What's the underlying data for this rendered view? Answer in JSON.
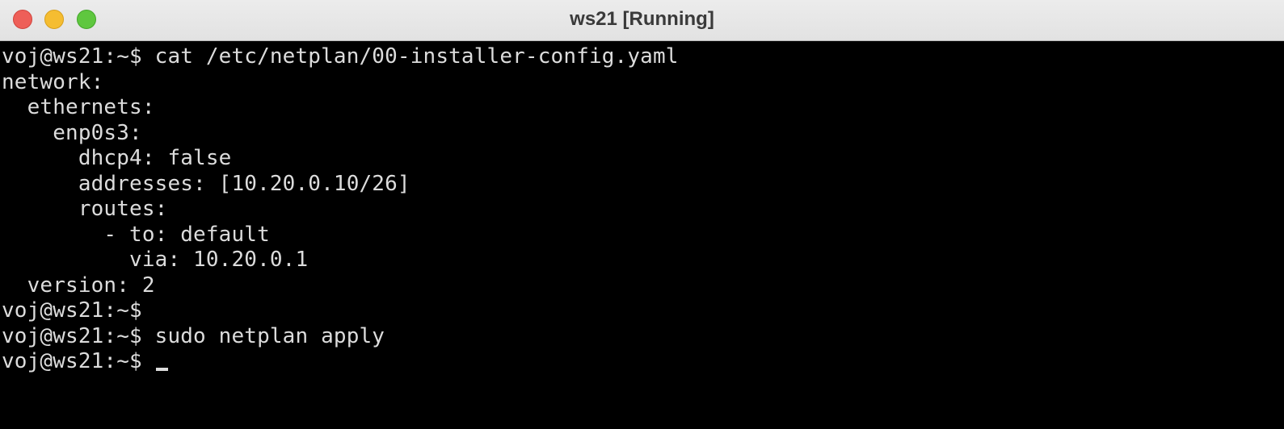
{
  "window": {
    "title": "ws21 [Running]"
  },
  "terminal": {
    "lines": [
      "voj@ws21:~$ cat /etc/netplan/00-installer-config.yaml",
      "network:",
      "  ethernets:",
      "    enp0s3:",
      "      dhcp4: false",
      "      addresses: [10.20.0.10/26]",
      "      routes:",
      "        - to: default",
      "          via: 10.20.0.1",
      "  version: 2",
      "voj@ws21:~$",
      "voj@ws21:~$ sudo netplan apply",
      "voj@ws21:~$ "
    ]
  },
  "colors": {
    "background": "#000000",
    "foreground": "#dcdcdc",
    "titlebar": "#e6e6e6"
  }
}
